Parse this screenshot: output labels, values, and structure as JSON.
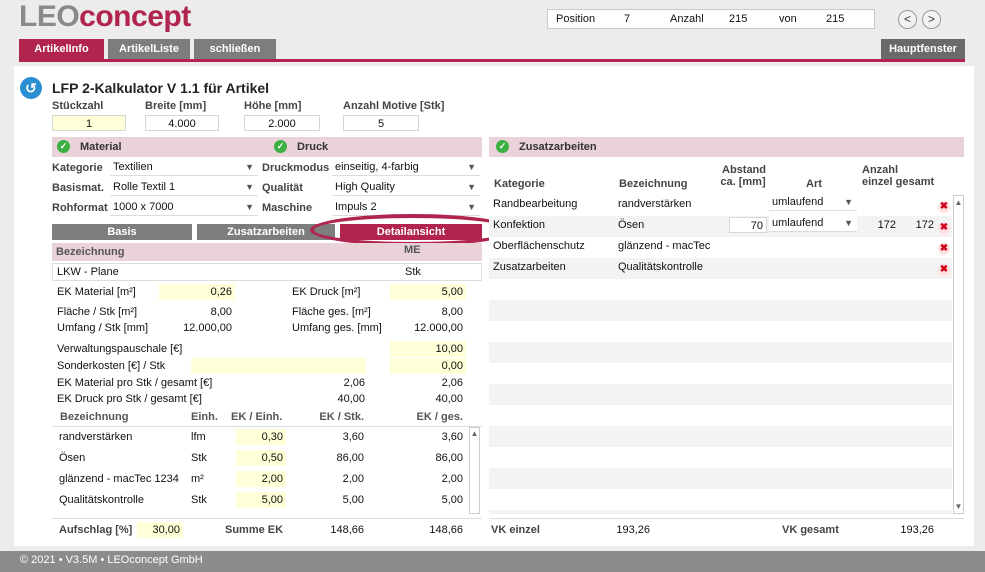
{
  "logo": {
    "part1": "LEO",
    "part2": "concept"
  },
  "nav": {
    "position_label": "Position",
    "position_value": "7",
    "count_label": "Anzahl",
    "count_value": "215",
    "of_label": "von",
    "of_value": "215",
    "prev": "<",
    "next": ">"
  },
  "tabs": {
    "artikelinfo": "ArtikelInfo",
    "artikelliste": "ArtikelListe",
    "close": "schließen",
    "main_window": "Hauptfenster"
  },
  "page_title": "LFP 2-Kalkulator V 1.1 für Artikel",
  "top_fields": [
    {
      "label": "Stückzahl",
      "value": "1"
    },
    {
      "label": "Breite [mm]",
      "value": "4.000"
    },
    {
      "label": "Höhe [mm]",
      "value": "2.000"
    },
    {
      "label": "Anzahl Motive [Stk]",
      "value": "5"
    }
  ],
  "material": {
    "title": "Material",
    "kategorie_label": "Kategorie",
    "kategorie_value": "Textilien",
    "basismat_label": "Basismat.",
    "basismat_value": "Rolle Textil 1",
    "rohformat_label": "Rohformat",
    "rohformat_value": "1000 x 7000"
  },
  "druck": {
    "title": "Druck",
    "druckmodus_label": "Druckmodus",
    "druckmodus_value": "einseitig, 4-farbig",
    "qualitaet_label": "Qualität",
    "qualitaet_value": "High Quality",
    "maschine_label": "Maschine",
    "maschine_value": "Impuls 2"
  },
  "view_buttons": {
    "basis": "Basis",
    "zusatz": "Zusatzarbeiten",
    "detail": "Detailansicht"
  },
  "detail": {
    "bez_header": "Bezeichnung",
    "me_header": "ME",
    "bez_value": "LKW - Plane",
    "me_value": "Stk",
    "ek_material_label": "EK Material [m²]",
    "ek_material_value": "0,26",
    "ek_druck_label": "EK Druck [m²]",
    "ek_druck_value": "5,00",
    "flaeche_stk_label": "Fläche / Stk [m²]",
    "flaeche_stk_value": "8,00",
    "flaeche_ges_label": "Fläche ges. [m²]",
    "flaeche_ges_value": "8,00",
    "umfang_stk_label": "Umfang / Stk [mm]",
    "umfang_stk_value": "12.000,00",
    "umfang_ges_label": "Umfang ges. [mm]",
    "umfang_ges_value": "12.000,00",
    "verwaltung_label": "Verwaltungspauschale [€]",
    "verwaltung_value": "10,00",
    "sonder_label": "Sonderkosten [€] / Stk",
    "sonder_value": "0,00",
    "ek_mat_pro_label": "EK Material pro Stk / gesamt [€]",
    "ek_mat_pro_stk": "2,06",
    "ek_mat_pro_ges": "2,06",
    "ek_druck_pro_label": "EK Druck pro Stk / gesamt [€]",
    "ek_druck_pro_stk": "40,00",
    "ek_druck_pro_ges": "40,00"
  },
  "items_table": {
    "headers": [
      "Bezeichnung",
      "Einh.",
      "EK / Einh.",
      "EK / Stk.",
      "EK / ges."
    ],
    "rows": [
      {
        "bez": "randverstärken",
        "einh": "lfm",
        "ek_einh": "0,30",
        "ek_stk": "3,60",
        "ek_ges": "3,60"
      },
      {
        "bez": "Ösen",
        "einh": "Stk",
        "ek_einh": "0,50",
        "ek_stk": "86,00",
        "ek_ges": "86,00"
      },
      {
        "bez": "glänzend - macTec 1234",
        "einh": "m²",
        "ek_einh": "2,00",
        "ek_stk": "2,00",
        "ek_ges": "2,00"
      },
      {
        "bez": "Qualitätskontrolle",
        "einh": "Stk",
        "ek_einh": "5,00",
        "ek_stk": "5,00",
        "ek_ges": "5,00"
      }
    ]
  },
  "summary": {
    "aufschlag_label": "Aufschlag [%]",
    "aufschlag_value": "30,00",
    "summe_label": "Summe EK",
    "summe_value": "148,66",
    "summe_total": "148,66"
  },
  "zusatz": {
    "title": "Zusatzarbeiten",
    "headers": {
      "kategorie": "Kategorie",
      "bezeichnung": "Bezeichnung",
      "abstand1": "Abstand",
      "abstand2": "ca. [mm]",
      "art": "Art",
      "anzahl1": "Anzahl",
      "anzahl2": "einzel gesamt"
    },
    "rows": [
      {
        "kategorie": "Randbearbeitung",
        "bezeichnung": "randverstärken",
        "abstand": "",
        "art": "umlaufend",
        "einzel": "",
        "gesamt": ""
      },
      {
        "kategorie": "Konfektion",
        "bezeichnung": "Ösen",
        "abstand": "70",
        "art": "umlaufend",
        "einzel": "172",
        "gesamt": "172"
      },
      {
        "kategorie": "Oberflächenschutz",
        "bezeichnung": "glänzend - macTec",
        "abstand": "",
        "art": "",
        "einzel": "",
        "gesamt": ""
      },
      {
        "kategorie": "Zusatzarbeiten",
        "bezeichnung": "Qualitätskontrolle",
        "abstand": "",
        "art": "",
        "einzel": "",
        "gesamt": ""
      }
    ]
  },
  "vk": {
    "einzel_label": "VK einzel",
    "einzel_value": "193,26",
    "gesamt_label": "VK gesamt",
    "gesamt_value": "193,26"
  },
  "footer": "© 2021 • V3.5M • LEOconcept GmbH",
  "colors": {
    "accent": "#b0244d",
    "section_bar": "#e9d3d8",
    "input_yellow": "#ffffd8",
    "button_gray": "#7d7d7d"
  }
}
